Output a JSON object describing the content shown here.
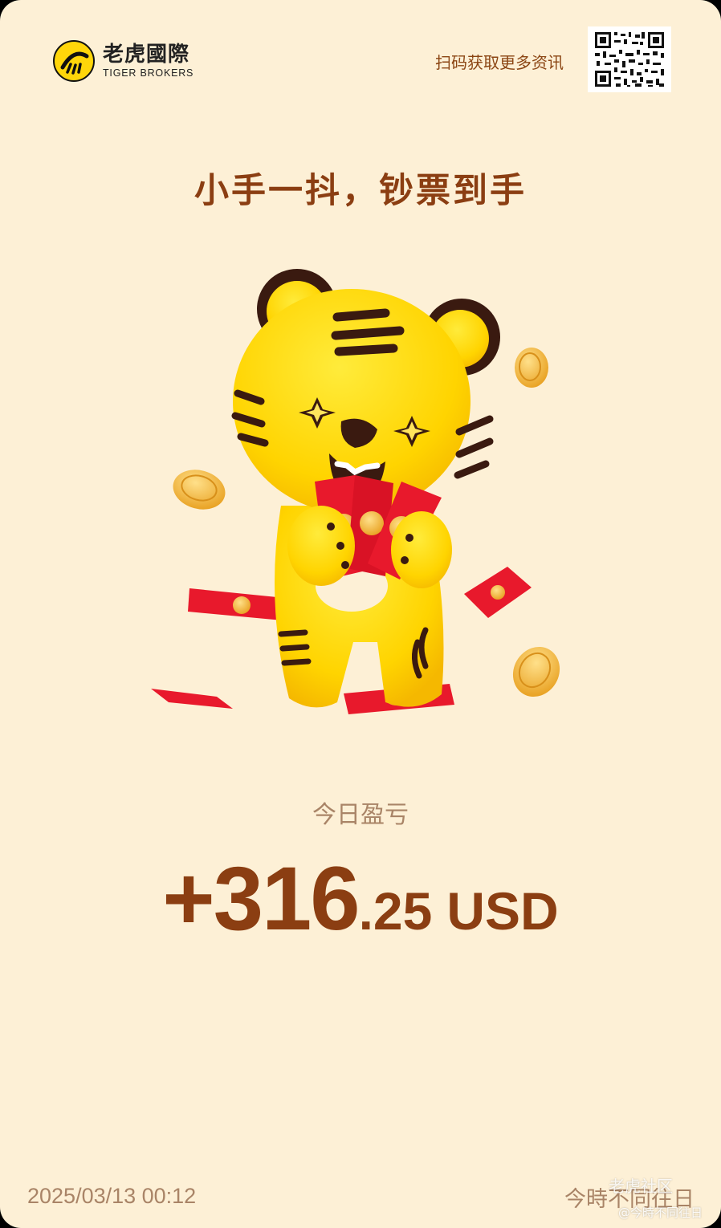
{
  "brand": {
    "name_cn": "老虎國際",
    "name_en": "TIGER BROKERS",
    "colors": {
      "yellow": "#FFD60A",
      "brown": "#8B3E12",
      "background": "#FDF0D6"
    }
  },
  "header": {
    "scan_tip": "扫码获取更多资讯",
    "qr_icon": "qr-code"
  },
  "slogan": "小手一抖，钞票到手",
  "illustration": {
    "icon": "tiger-mascot-holding-red-envelopes"
  },
  "pnl": {
    "label": "今日盈亏",
    "sign_integer": "+316",
    "decimal": ".25",
    "currency": "USD"
  },
  "footer": {
    "datetime": "2025/03/13 00:12",
    "motto": "今時不同往日"
  },
  "watermark": {
    "line1": "老虎社区",
    "line2": "@今時不同往日"
  }
}
